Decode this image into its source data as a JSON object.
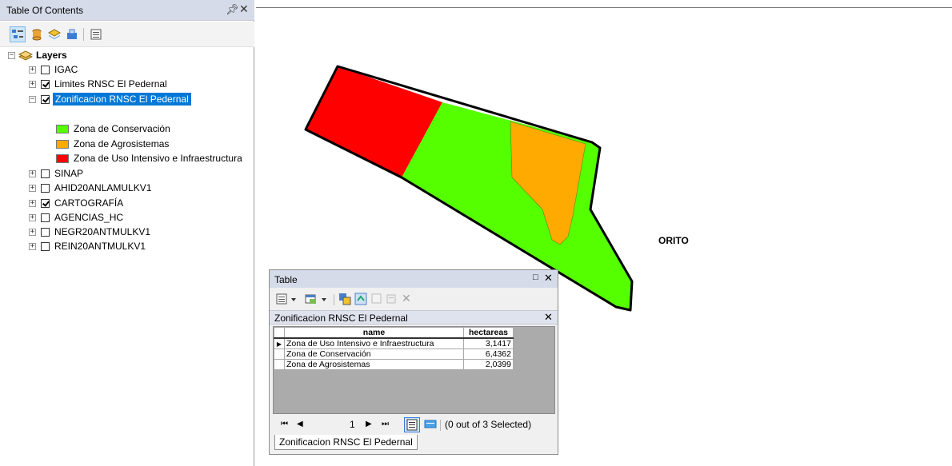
{
  "toc": {
    "title": "Table Of Contents",
    "pin": "X",
    "close": "✕",
    "root_label": "Layers",
    "layers": [
      {
        "label": "IGAC",
        "checked": false
      },
      {
        "label": "Limites RNSC El Pedernal",
        "checked": true
      },
      {
        "label": "Zonificacion RNSC El Pedernal",
        "checked": true,
        "selected": true,
        "expanded": true
      },
      {
        "label": "SINAP",
        "checked": false
      },
      {
        "label": "AHID20ANLAMULKV1",
        "checked": false
      },
      {
        "label": "CARTOGRAFÍA",
        "checked": true
      },
      {
        "label": "AGENCIAS_HC",
        "checked": false
      },
      {
        "label": "NEGR20ANTMULKV1",
        "checked": false
      },
      {
        "label": "REIN20ANTMULKV1",
        "checked": false
      }
    ],
    "legend": [
      {
        "label": "Zona de Conservación",
        "color": "#55ff00"
      },
      {
        "label": "Zona de Agrosistemas",
        "color": "#ffaa00"
      },
      {
        "label": "Zona de Uso Intensivo e Infraestructura",
        "color": "#ff0000"
      }
    ]
  },
  "map": {
    "place_label": "ORITO",
    "colors": {
      "conservation": "#55ff00",
      "agro": "#ffaa00",
      "intensive": "#ff0000",
      "outline": "#000000"
    }
  },
  "table": {
    "window_title": "Table",
    "layer_name": "Zonificacion RNSC El Pedernal",
    "columns": [
      "name",
      "hectareas"
    ],
    "rows": [
      {
        "name": "Zona de Uso Intensivo e Infraestructura",
        "hectareas": "3,1417",
        "current": true
      },
      {
        "name": "Zona de Conservación",
        "hectareas": "6,4362",
        "current": false
      },
      {
        "name": "Zona de Agrosistemas",
        "hectareas": "2,0399",
        "current": false
      }
    ],
    "page": "1",
    "selection_status": "(0 out of 3 Selected)",
    "tab_label": "Zonificacion RNSC El Pedernal"
  }
}
